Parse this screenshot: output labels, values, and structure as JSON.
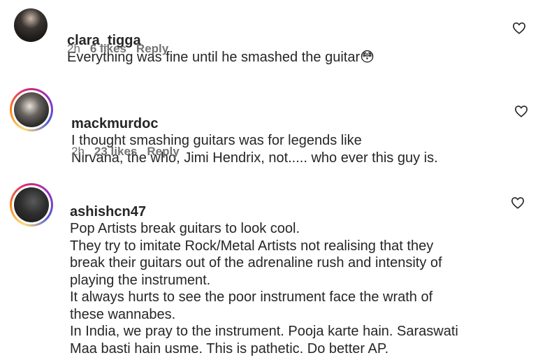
{
  "comments": [
    {
      "username": "clara_tigga",
      "text": "Everything was fine until he smashed the guitar😳",
      "time": "2h",
      "likes": "6 likes",
      "reply": "Reply",
      "avatar_icon": "avatar-photo-dark-hair"
    },
    {
      "username": "mackmurdoc",
      "text": "I thought smashing guitars was for legends like\nNirvana, the who, Jimi Hendrix, not..... who ever this guy is.",
      "time": "2h",
      "likes": "23 likes",
      "reply": "Reply",
      "avatar_icon": "avatar-photo-guitarist"
    },
    {
      "username": "ashishcn47",
      "text": "Pop Artists break guitars to look cool.\nThey try to imitate Rock/Metal Artists not realising that they\nbreak their guitars out of the adrenaline rush and intensity of\nplaying the instrument.\nIt always hurts to see the poor instrument face the wrath of\nthese wannabes.\nIn India, we pray to the instrument. Pooja karte hain. Saraswati\nMaa basti hain usme. This is pathetic. Do better AP.",
      "avatar_icon": "avatar-photo-dark-room"
    }
  ],
  "colors": {
    "text": "#262626",
    "meta": "#737373",
    "story_ring": [
      "#feda75",
      "#fa7e1e",
      "#d62976",
      "#962fbf",
      "#4f5bd5"
    ]
  },
  "icons": {
    "like": "heart-outline-icon"
  }
}
